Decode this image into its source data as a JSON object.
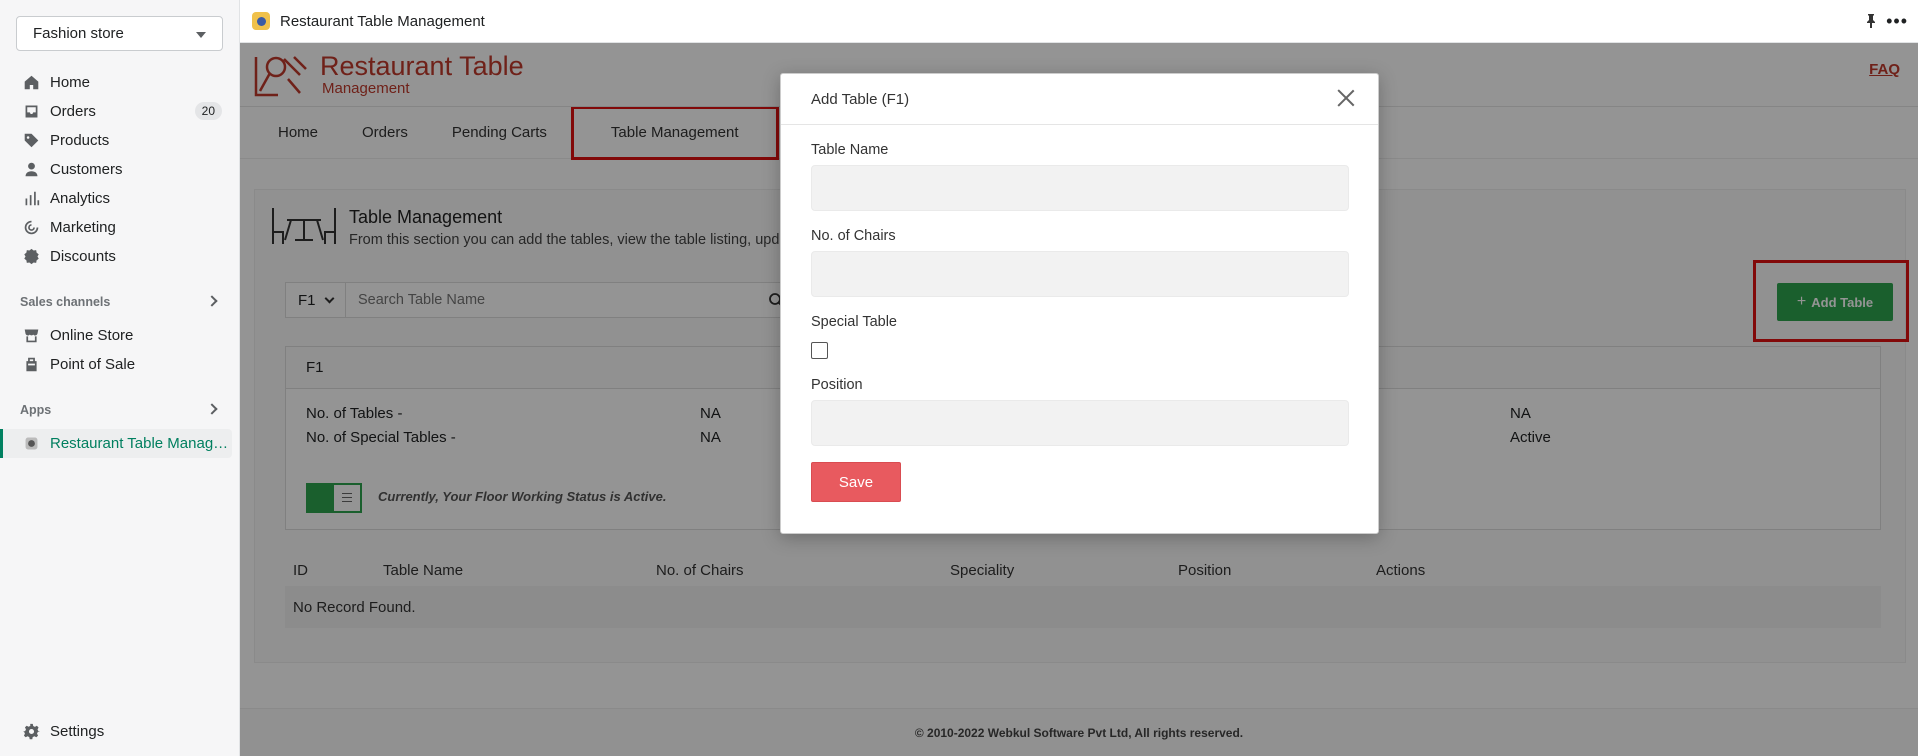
{
  "sidebar": {
    "store": "Fashion store",
    "nav": [
      {
        "label": "Home",
        "icon": "home-icon"
      },
      {
        "label": "Orders",
        "icon": "orders-icon",
        "badge": "20"
      },
      {
        "label": "Products",
        "icon": "tag-icon"
      },
      {
        "label": "Customers",
        "icon": "person-icon"
      },
      {
        "label": "Analytics",
        "icon": "bar-chart-icon"
      },
      {
        "label": "Marketing",
        "icon": "target-icon"
      },
      {
        "label": "Discounts",
        "icon": "discount-icon"
      }
    ],
    "sales_channels": {
      "heading": "Sales channels",
      "items": [
        {
          "label": "Online Store",
          "icon": "store-icon"
        },
        {
          "label": "Point of Sale",
          "icon": "pos-icon"
        }
      ]
    },
    "apps": {
      "heading": "Apps",
      "items": [
        {
          "label": "Restaurant Table Manag…",
          "icon": "app-icon"
        }
      ]
    },
    "settings": "Settings"
  },
  "topbar": {
    "title": "Restaurant Table Management"
  },
  "app": {
    "logo": {
      "line1": "Restaurant Table",
      "line2": "Management"
    },
    "faq": "FAQ",
    "tabs": [
      "Home",
      "Orders",
      "Pending Carts",
      "Table Management"
    ],
    "page_title": "Table Management",
    "page_desc": "From this section you can add the tables, view the table listing, update",
    "floor_select": "F1",
    "search_placeholder": "Search Table Name",
    "add_button": "Add Table",
    "floor_card": {
      "title": "F1",
      "rows": [
        {
          "label": "No. of Tables -",
          "value1": "NA",
          "value2": "NA"
        },
        {
          "label": "No. of Special Tables -",
          "value1": "NA",
          "value2": "Active"
        }
      ],
      "status_text": "Currently, Your Floor Working Status is Active."
    },
    "table": {
      "columns": [
        "ID",
        "Table Name",
        "No. of Chairs",
        "Speciality",
        "Position",
        "Actions"
      ],
      "empty": "No Record Found."
    },
    "footer": "© 2010-2022 Webkul Software Pvt Ltd, All rights reserved."
  },
  "modal": {
    "title": "Add Table (F1)",
    "fields": {
      "table_name": {
        "label": "Table Name",
        "value": ""
      },
      "chairs": {
        "label": "No. of Chairs",
        "value": ""
      },
      "special": {
        "label": "Special Table",
        "checked": false
      },
      "position": {
        "label": "Position",
        "value": ""
      }
    },
    "save": "Save"
  },
  "colors": {
    "brand_red": "#c0392b",
    "highlight_red": "#e01010",
    "add_green": "#2ea44f",
    "save_red": "#e85a5f",
    "shopify_green": "#008060"
  }
}
